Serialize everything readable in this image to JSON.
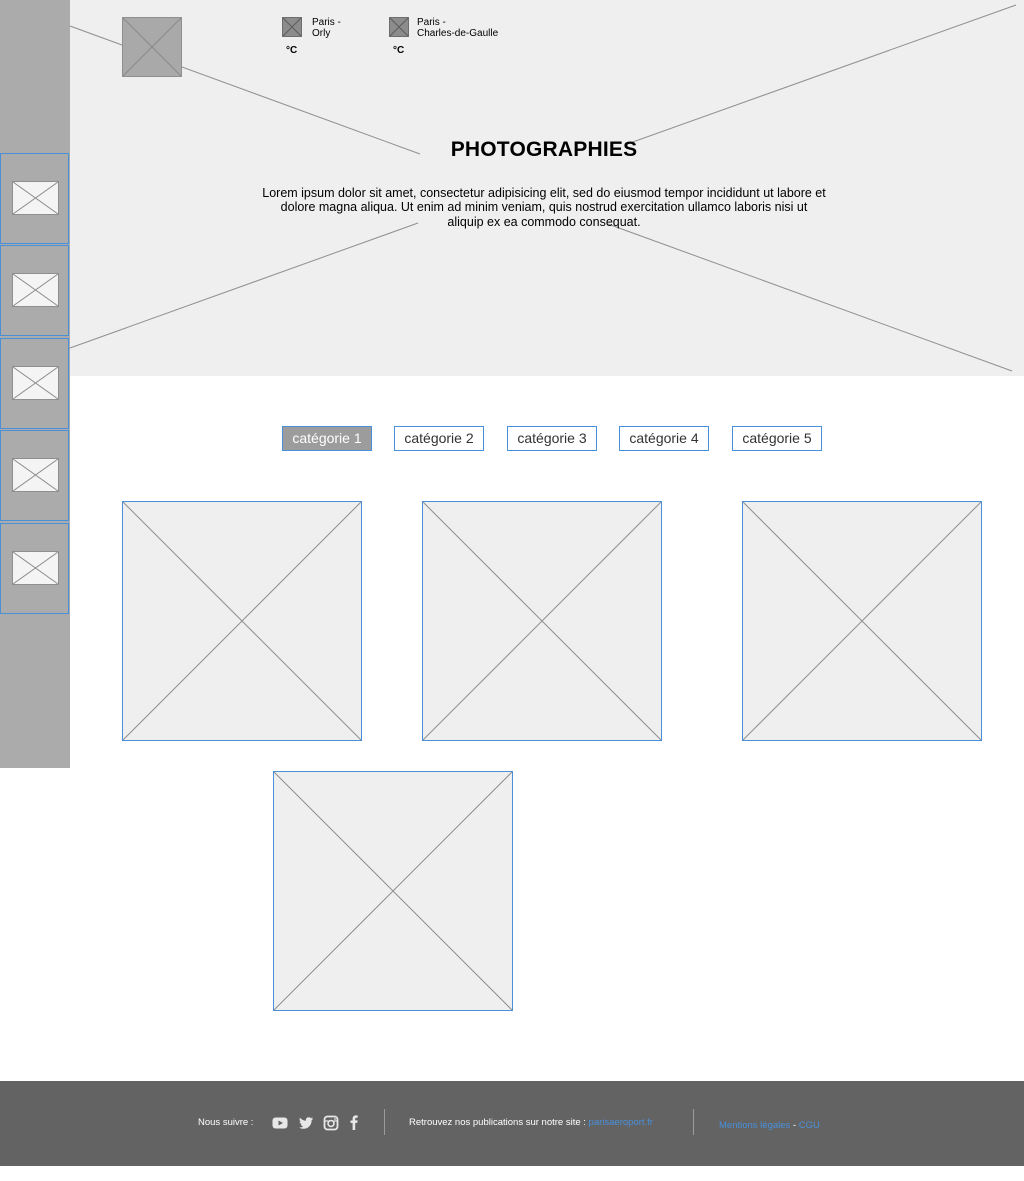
{
  "header": {
    "weather": [
      {
        "location": "Paris -\nOrly",
        "temp": "°C"
      },
      {
        "location": "Paris -\nCharles-de-Gaulle",
        "temp": "°C"
      }
    ],
    "title": "PHOTOGRAPHIES",
    "description": "Lorem ipsum dolor sit amet, consectetur adipisicing elit, sed do eiusmod tempor incididunt ut labore et dolore magna aliqua. Ut enim ad minim veniam, quis nostrud exercitation ullamco laboris nisi ut aliquip ex ea commodo consequat."
  },
  "sidebar": {
    "items": [
      "image",
      "image",
      "image",
      "image",
      "image"
    ]
  },
  "categories": {
    "items": [
      "catégorie 1",
      "catégorie 2",
      "catégorie 3",
      "catégorie 4",
      "catégorie 5"
    ],
    "active_index": 0
  },
  "gallery": {
    "photo_count": 4
  },
  "footer": {
    "follow_label": "Nous suivre :",
    "social_icons": [
      "youtube-icon",
      "twitter-icon",
      "instagram-icon",
      "facebook-icon"
    ],
    "publications_text": "Retrouvez nos publications sur notre site : ",
    "publications_link": "parisaeroport.fr",
    "legal_link": "Mentions légales",
    "separator": " - ",
    "cgu_link": "CGU"
  },
  "colors": {
    "accent": "#4a90d9",
    "footer_bg": "#636363",
    "sidebar_bg": "#ababab",
    "placeholder_bg": "#efefef"
  }
}
